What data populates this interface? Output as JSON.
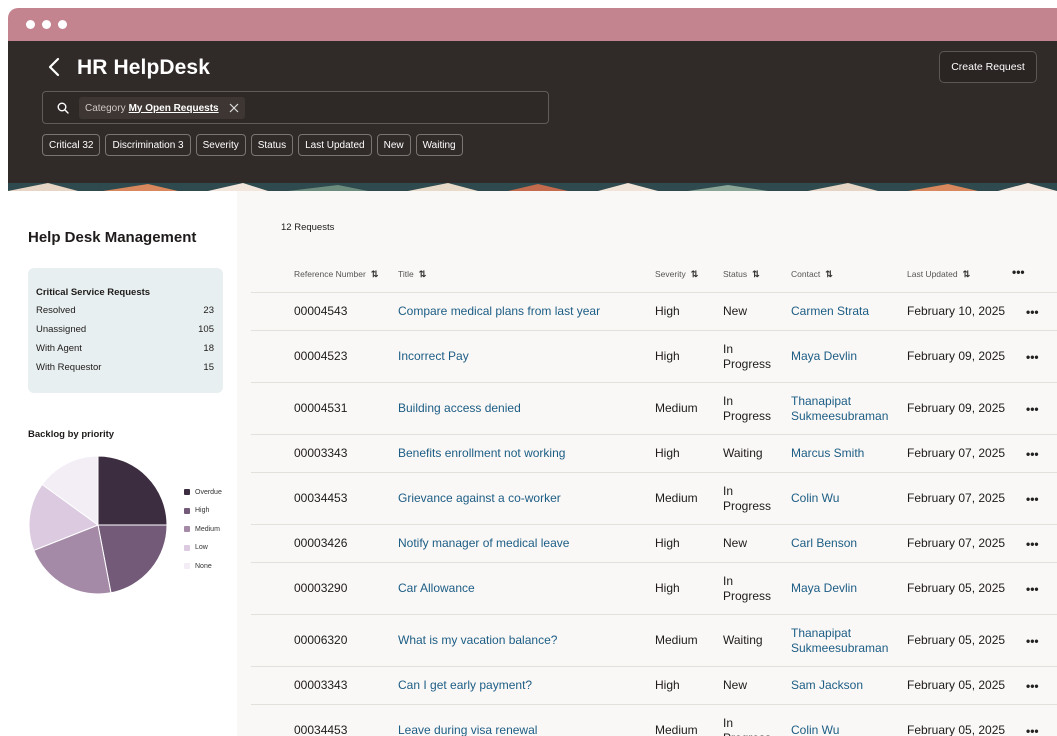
{
  "app": {
    "title": "HR HelpDesk",
    "create_label": "Create Request"
  },
  "search": {
    "chip_label": "Category",
    "chip_value": "My Open Requests"
  },
  "filters": [
    "Critical 32",
    "Discrimination 3",
    "Severity",
    "Status",
    "Last Updated",
    "New",
    "Waiting"
  ],
  "sidebar": {
    "title": "Help Desk Management",
    "card": {
      "title": "Critical Service Requests",
      "rows": [
        {
          "label": "Resolved",
          "value": "23"
        },
        {
          "label": "Unassigned",
          "value": "105"
        },
        {
          "label": "With Agent",
          "value": "18"
        },
        {
          "label": "With Requestor",
          "value": "15"
        }
      ]
    },
    "backlog_title": "Backlog by priority"
  },
  "chart_data": {
    "type": "pie",
    "title": "Backlog by priority",
    "labels": [
      "Overdue",
      "High",
      "Medium",
      "Low",
      "None"
    ],
    "values": [
      25,
      22,
      22,
      16,
      15
    ],
    "colors": [
      "#3d2d40",
      "#725a78",
      "#a58aa8",
      "#dccbe0",
      "#f3edf6"
    ],
    "legend": "right"
  },
  "table": {
    "count_label": "12 Requests",
    "columns": [
      "Reference Number",
      "Title",
      "Severity",
      "Status",
      "Contact",
      "Last Updated"
    ],
    "rows": [
      {
        "ref": "00004543",
        "title": "Compare medical plans from last year",
        "severity": "High",
        "status": "New",
        "contact": "Carmen Strata",
        "updated": "February 10, 2025"
      },
      {
        "ref": "00004523",
        "title": "Incorrect Pay",
        "severity": "High",
        "status": "In Progress",
        "contact": "Maya Devlin",
        "updated": "February 09, 2025"
      },
      {
        "ref": "00004531",
        "title": "Building access denied",
        "severity": "Medium",
        "status": "In Progress",
        "contact": "Thanapipat Sukmeesubraman",
        "updated": "February 09, 2025"
      },
      {
        "ref": "00003343",
        "title": "Benefits enrollment not working",
        "severity": "High",
        "status": "Waiting",
        "contact": "Marcus Smith",
        "updated": "February 07, 2025"
      },
      {
        "ref": "00034453",
        "title": "Grievance against a co-worker",
        "severity": "Medium",
        "status": "In Progress",
        "contact": "Colin Wu",
        "updated": "February 07, 2025"
      },
      {
        "ref": "00003426",
        "title": "Notify manager of medical leave",
        "severity": "High",
        "status": "New",
        "contact": "Carl Benson",
        "updated": "February 07, 2025"
      },
      {
        "ref": "00003290",
        "title": "Car Allowance",
        "severity": "High",
        "status": "In Progress",
        "contact": "Maya Devlin",
        "updated": "February 05, 2025"
      },
      {
        "ref": "00006320",
        "title": "What is my vacation balance?",
        "severity": "Medium",
        "status": "Waiting",
        "contact": "Thanapipat Sukmeesubraman",
        "updated": "February 05, 2025"
      },
      {
        "ref": "00003343",
        "title": "Can I get early payment?",
        "severity": "High",
        "status": "New",
        "contact": "Sam Jackson",
        "updated": "February 05, 2025"
      },
      {
        "ref": "00034453",
        "title": "Leave during visa renewal",
        "severity": "Medium",
        "status": "In Progress",
        "contact": "Colin Wu",
        "updated": "February 05, 2025"
      }
    ]
  },
  "colors": {
    "header_bg": "#302a28",
    "frame_accent": "#c4848f",
    "link": "#1c5d85",
    "card_bg": "#e8eff0"
  }
}
